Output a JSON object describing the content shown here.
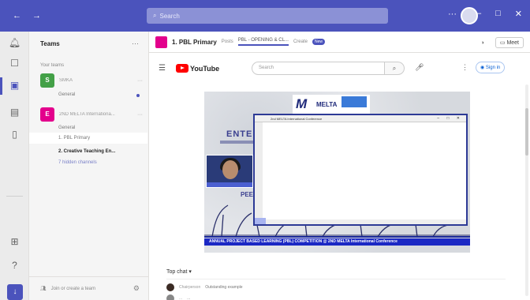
{
  "titlebar": {
    "search_placeholder": "Search",
    "more": "···",
    "back": "←",
    "forward": "→",
    "minimize": "–",
    "maximize": "□",
    "close": "✕"
  },
  "rail": {
    "icons": [
      "activity-icon",
      "chat-icon",
      "teams-icon",
      "calendar-icon",
      "files-icon",
      "apps-icon",
      "help-icon",
      "download-icon"
    ]
  },
  "teams_pane": {
    "title": "Teams",
    "section_label": "Your teams",
    "teams": [
      {
        "initial": "S",
        "color": "#43a047",
        "name": "SMKA",
        "channels": [
          "General"
        ]
      },
      {
        "initial": "E",
        "color": "#e3008c",
        "name": "2ND MELTA Internationa...",
        "channels": [
          "General",
          "1. PBL Primary",
          "2. Creative Teaching En...",
          "7 hidden channels"
        ]
      }
    ],
    "footer": "Join or create a team"
  },
  "channel_header": {
    "title": "1. PBL Primary",
    "tabs": [
      "Posts",
      "PBL - OPENING & CL...",
      "Create"
    ],
    "badge": "New",
    "meet": "Meet"
  },
  "youtube": {
    "logo_text": "YouTube",
    "search_placeholder": "Search",
    "signin": "Sign in"
  },
  "video": {
    "heading": "ENTE",
    "sub_heading": "PEE",
    "logo_text": "MELTA",
    "ribbon": "ANNUAL PROJECT BASED LEARNING (PBL) COMPETITION @ 2ND MELTA International Conference",
    "shared_window_title": "2nd MELTA International Conference"
  },
  "comments": {
    "label": "Top chat",
    "rows": [
      {
        "name": "Chairperson",
        "text": "Outstanding example"
      },
      {
        "name": "...",
        "text": "..."
      }
    ]
  }
}
